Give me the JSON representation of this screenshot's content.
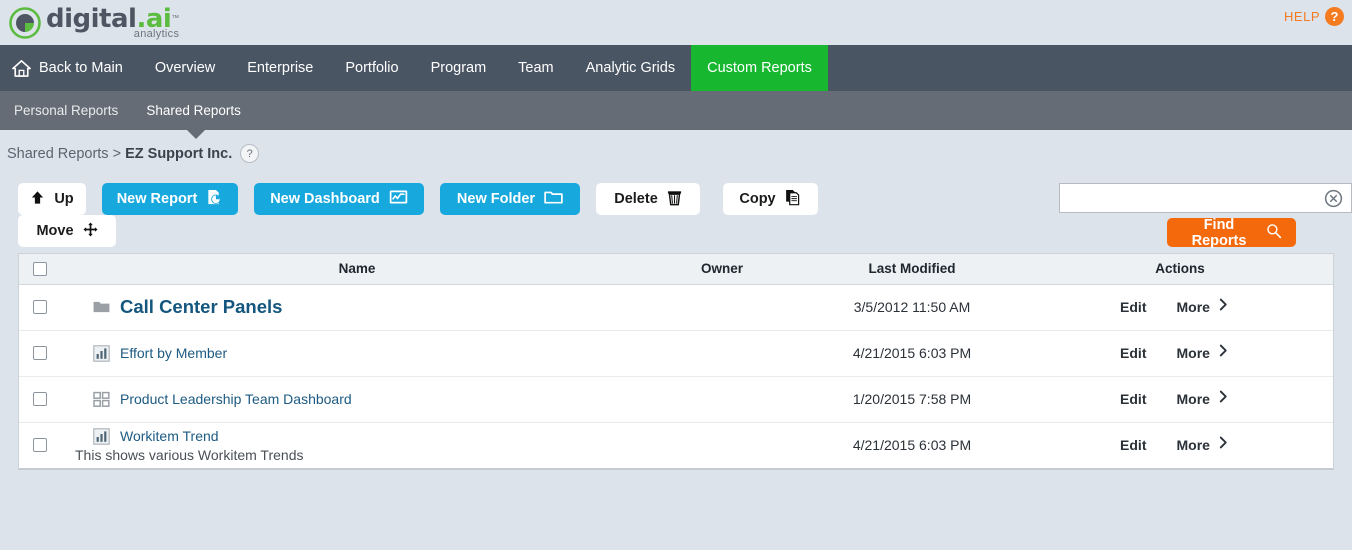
{
  "banner": {
    "logo_word": "digital",
    "logo_dot": ".ai",
    "logo_tm": "™",
    "logo_sub": "analytics",
    "help_label": "HELP",
    "help_glyph": "?"
  },
  "mainnav": {
    "items": [
      {
        "label": "Back to Main",
        "icon": "home-icon",
        "active": false
      },
      {
        "label": "Overview",
        "active": false
      },
      {
        "label": "Enterprise",
        "active": false
      },
      {
        "label": "Portfolio",
        "active": false
      },
      {
        "label": "Program",
        "active": false
      },
      {
        "label": "Team",
        "active": false
      },
      {
        "label": "Analytic Grids",
        "active": false
      },
      {
        "label": "Custom Reports",
        "active": true
      }
    ],
    "active_color": "#17b830"
  },
  "subnav": {
    "items": [
      {
        "label": "Personal Reports",
        "active": false
      },
      {
        "label": "Shared Reports",
        "active": true
      }
    ]
  },
  "breadcrumb": {
    "root": "Shared Reports",
    "separator": ">",
    "current": "EZ Support Inc.",
    "help_glyph": "?"
  },
  "toolbar": {
    "up_label": "Up",
    "move_label": "Move",
    "new_report_label": "New Report",
    "new_dashboard_label": "New Dashboard",
    "new_folder_label": "New Folder",
    "delete_label": "Delete",
    "copy_label": "Copy",
    "find_label": "Find Reports",
    "accent_blue": "#17a8dd",
    "accent_orange": "#f4690b"
  },
  "search": {
    "value": "",
    "placeholder": ""
  },
  "table": {
    "headers": {
      "name": "Name",
      "owner": "Owner",
      "last_modified": "Last Modified",
      "actions": "Actions"
    },
    "rows": [
      {
        "name": "Call Center Panels",
        "icon": "folder-icon",
        "type": "folder",
        "description": "",
        "owner": "",
        "last_modified": "3/5/2012 11:50 AM",
        "edit_label": "Edit",
        "more_label": "More"
      },
      {
        "name": "Effort by Member",
        "icon": "bar-chart-icon",
        "type": "report",
        "description": "",
        "owner": "",
        "last_modified": "4/21/2015 6:03 PM",
        "edit_label": "Edit",
        "more_label": "More"
      },
      {
        "name": "Product Leadership Team Dashboard",
        "icon": "dashboard-grid-icon",
        "type": "dashboard",
        "description": "",
        "owner": "",
        "last_modified": "1/20/2015 7:58 PM",
        "edit_label": "Edit",
        "more_label": "More"
      },
      {
        "name": "Workitem Trend",
        "icon": "bar-chart-icon",
        "type": "report",
        "description": "This shows various Workitem Trends",
        "owner": "",
        "last_modified": "4/21/2015 6:03 PM",
        "edit_label": "Edit",
        "more_label": "More"
      }
    ]
  }
}
